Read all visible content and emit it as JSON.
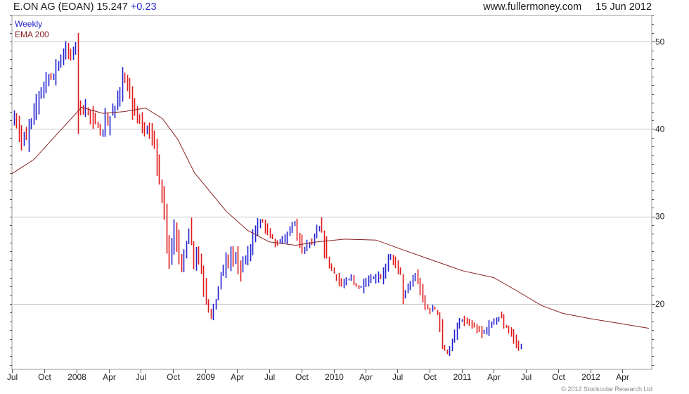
{
  "header": {
    "title": "E.ON AG (EOAN)",
    "price": "15.247",
    "change": "+0.23",
    "site": "www.fullermoney.com",
    "date": "15 Jun 2012"
  },
  "footer": {
    "copyright": "© 2012 Stockcube Research Ltd"
  },
  "colors": {
    "up": "#1f1fd0",
    "down": "#e01818",
    "ema": "#8a2020",
    "grid": "#c8c8c8",
    "axis": "#555555"
  },
  "chart_data": {
    "type": "candlestick",
    "legend": [
      {
        "label": "Weekly",
        "color": "#1f1fd0"
      },
      {
        "label": "EMA 200",
        "color": "#8a2020"
      }
    ],
    "y_axis": {
      "side": "right",
      "ylim": [
        12.5,
        53
      ],
      "ticks": [
        20,
        30,
        40,
        50
      ]
    },
    "x_axis": {
      "range": [
        "2007-07-01",
        "2012-06-23"
      ],
      "ticks": [
        {
          "label": "Jul",
          "date": "2007-07-01"
        },
        {
          "label": "Oct",
          "date": "2007-10-01"
        },
        {
          "label": "2008",
          "date": "2008-01-01"
        },
        {
          "label": "Apr",
          "date": "2008-04-01"
        },
        {
          "label": "Jul",
          "date": "2008-07-01"
        },
        {
          "label": "Oct",
          "date": "2008-10-01"
        },
        {
          "label": "2009",
          "date": "2009-01-01"
        },
        {
          "label": "Apr",
          "date": "2009-04-01"
        },
        {
          "label": "Jul",
          "date": "2009-07-01"
        },
        {
          "label": "Oct",
          "date": "2009-10-01"
        },
        {
          "label": "2010",
          "date": "2010-01-01"
        },
        {
          "label": "Apr",
          "date": "2010-04-01"
        },
        {
          "label": "Jul",
          "date": "2010-07-01"
        },
        {
          "label": "Oct",
          "date": "2010-10-01"
        },
        {
          "label": "2011",
          "date": "2011-01-01"
        },
        {
          "label": "Apr",
          "date": "2011-04-01"
        },
        {
          "label": "Jul",
          "date": "2011-07-01"
        },
        {
          "label": "Oct",
          "date": "2011-10-01"
        },
        {
          "label": "2012",
          "date": "2012-01-01"
        },
        {
          "label": "Apr",
          "date": "2012-04-01"
        }
      ]
    },
    "weekly_close": {
      "start": "2007-07-06",
      "values": [
        41.2,
        40.6,
        39.5,
        38.4,
        39.4,
        38.8,
        40.4,
        41.1,
        42.1,
        42.9,
        43.9,
        44.6,
        45.1,
        45.7,
        46.0,
        45.8,
        46.3,
        47.1,
        47.6,
        48.1,
        48.6,
        49.0,
        48.7,
        48.5,
        49.0,
        49.3,
        43.0,
        42.5,
        41.8,
        42.3,
        42.0,
        41.5,
        41.0,
        40.8,
        40.2,
        39.5,
        39.6,
        41.0,
        40.5,
        41.5,
        42.0,
        42.5,
        43.5,
        44.5,
        45.8,
        45.3,
        44.5,
        43.5,
        42.5,
        42.0,
        41.5,
        41.0,
        40.0,
        39.5,
        40.0,
        39.7,
        39.1,
        37.9,
        36.0,
        34.0,
        32.5,
        30.5,
        27.5,
        25.0,
        26.5,
        28.5,
        27.0,
        25.5,
        24.5,
        25.5,
        27.0,
        28.5,
        27.0,
        25.0,
        26.0,
        25.2,
        23.5,
        22.0,
        20.5,
        19.5,
        18.5,
        19.5,
        20.5,
        22.0,
        23.5,
        24.0,
        25.0,
        24.5,
        26.0,
        25.0,
        25.5,
        24.5,
        23.5,
        25.0,
        25.0,
        25.8,
        26.6,
        27.5,
        28.3,
        29.0,
        29.5,
        29.4,
        28.8,
        28.4,
        27.8,
        27.5,
        27.0,
        26.8,
        27.0,
        27.3,
        27.6,
        28.0,
        28.5,
        28.9,
        29.4,
        28.0,
        27.0,
        26.0,
        26.5,
        26.8,
        27.0,
        27.0,
        27.5,
        28.3,
        28.8,
        28.2,
        26.5,
        25.5,
        24.5,
        24.0,
        23.5,
        23.0,
        22.5,
        22.2,
        22.3,
        22.6,
        22.8,
        23.0,
        22.5,
        22.0,
        21.8,
        22.0,
        22.3,
        22.5,
        22.7,
        22.8,
        22.9,
        23.0,
        23.2,
        23.0,
        23.5,
        24.2,
        25.0,
        25.3,
        25.0,
        24.5,
        24.0,
        23.5,
        21.0,
        21.2,
        21.8,
        22.3,
        22.8,
        23.2,
        22.5,
        21.5,
        20.5,
        19.8,
        19.5,
        19.2,
        19.5,
        19.4,
        19.0,
        17.5,
        15.0,
        14.8,
        14.5,
        14.8,
        15.5,
        16.5,
        17.3,
        17.8,
        18.2,
        18.0,
        17.8,
        17.6,
        17.5,
        17.3,
        17.0,
        16.8,
        16.6,
        16.7,
        17.0,
        17.5,
        17.8,
        18.0,
        18.3,
        18.5,
        18.4,
        17.5,
        17.3,
        17.0,
        16.5,
        16.0,
        15.5,
        15.0,
        15.25
      ]
    },
    "ema200": {
      "points": [
        {
          "date": "2007-07-01",
          "value": 34.9
        },
        {
          "date": "2007-09-01",
          "value": 36.5
        },
        {
          "date": "2007-11-01",
          "value": 39.2
        },
        {
          "date": "2008-01-15",
          "value": 42.5
        },
        {
          "date": "2008-03-15",
          "value": 41.8
        },
        {
          "date": "2008-05-15",
          "value": 42.0
        },
        {
          "date": "2008-07-15",
          "value": 42.4
        },
        {
          "date": "2008-09-01",
          "value": 41.2
        },
        {
          "date": "2008-10-15",
          "value": 38.8
        },
        {
          "date": "2008-12-01",
          "value": 35.0
        },
        {
          "date": "2009-01-15",
          "value": 32.8
        },
        {
          "date": "2009-03-01",
          "value": 30.6
        },
        {
          "date": "2009-05-01",
          "value": 28.4
        },
        {
          "date": "2009-07-01",
          "value": 27.1
        },
        {
          "date": "2009-09-15",
          "value": 26.7
        },
        {
          "date": "2009-11-15",
          "value": 27.1
        },
        {
          "date": "2010-02-01",
          "value": 27.4
        },
        {
          "date": "2010-05-01",
          "value": 27.3
        },
        {
          "date": "2010-07-15",
          "value": 26.2
        },
        {
          "date": "2010-10-01",
          "value": 25.1
        },
        {
          "date": "2011-01-01",
          "value": 23.8
        },
        {
          "date": "2011-04-01",
          "value": 23.0
        },
        {
          "date": "2011-06-01",
          "value": 21.6
        },
        {
          "date": "2011-08-15",
          "value": 19.8
        },
        {
          "date": "2011-10-15",
          "value": 18.9
        },
        {
          "date": "2012-01-01",
          "value": 18.3
        },
        {
          "date": "2012-04-01",
          "value": 17.7
        },
        {
          "date": "2012-06-15",
          "value": 17.2
        }
      ]
    }
  }
}
